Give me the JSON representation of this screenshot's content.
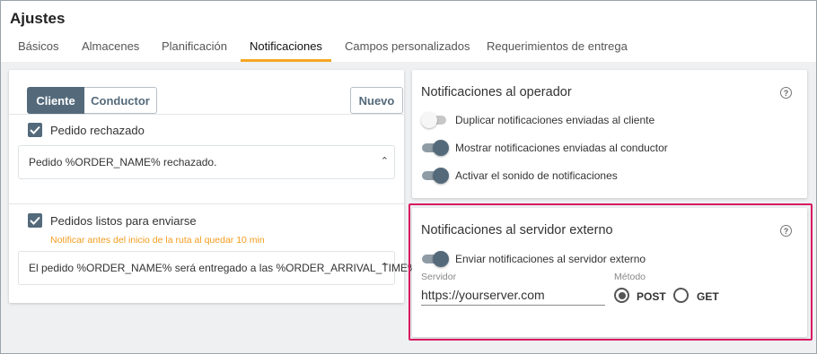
{
  "header": {
    "title": "Ajustes",
    "tabs": [
      {
        "label": "Básicos"
      },
      {
        "label": "Almacenes"
      },
      {
        "label": "Planificación"
      },
      {
        "label": "Notificaciones"
      },
      {
        "label": "Campos personalizados"
      },
      {
        "label": "Requerimientos de entrega"
      }
    ],
    "active_tab": "Notificaciones"
  },
  "left_panel": {
    "segment": {
      "client": "Cliente",
      "driver": "Conductor",
      "selected": "Cliente"
    },
    "new_button": "Nuevo",
    "items": [
      {
        "checked": true,
        "label": "Pedido rechazado",
        "hint": "",
        "message": "Pedido %ORDER_NAME% rechazado."
      },
      {
        "checked": true,
        "label": "Pedidos listos para enviarse",
        "hint": "Notificar antes del inicio de la ruta al quedar 10 min",
        "message": "El pedido %ORDER_NAME% será entregado a las %ORDER_ARRIVAL_TIME%."
      }
    ]
  },
  "operator_panel": {
    "title": "Notificaciones al operador",
    "toggles": [
      {
        "label": "Duplicar notificaciones enviadas al cliente",
        "on": false
      },
      {
        "label": "Mostrar notificaciones enviadas al conductor",
        "on": true
      },
      {
        "label": "Activar el sonido de notificaciones",
        "on": true
      }
    ]
  },
  "external_panel": {
    "title": "Notificaciones al servidor externo",
    "toggle": {
      "label": "Enviar notificaciones al servidor externo",
      "on": true
    },
    "server_label": "Servidor",
    "server_value": "https://yourserver.com",
    "method_label": "Método",
    "methods": [
      {
        "label": "POST",
        "selected": true
      },
      {
        "label": "GET",
        "selected": false
      }
    ]
  },
  "colors": {
    "accent": "#546a7b",
    "tab_underline": "#f5a623",
    "hint": "#f39c1f",
    "highlight_border": "#d81b60"
  }
}
